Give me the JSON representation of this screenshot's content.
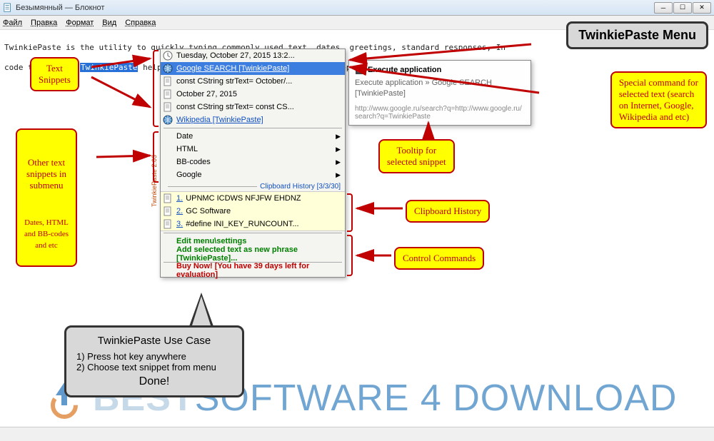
{
  "window": {
    "title": "Безымянный — Блокнот"
  },
  "menubar": [
    "Файл",
    "Правка",
    "Формат",
    "Вид",
    "Справка"
  ],
  "editor": {
    "line1_pre": "TwinkiePaste is the utility to quickly typing commonly used text, dates, greetings, standard responses, In",
    "line2_pre": "code templates. ",
    "sel": "TwinkiePaste",
    "line2_post": " helps to quickly type text in almost any application, thus saving a lot of ti"
  },
  "popup": {
    "version_label": "TwinkiePaste 2.03",
    "top": [
      {
        "icon": "clock-icon",
        "label": "Tuesday, October 27, 2015 13:2..."
      },
      {
        "icon": "globe-icon",
        "label": "Google SEARCH [TwinkiePaste]",
        "hl": true,
        "link": true
      },
      {
        "icon": "page-icon",
        "label": "const CString strText= October/..."
      },
      {
        "icon": "page-icon",
        "label": "October 27, 2015"
      },
      {
        "icon": "page-icon",
        "label": "const CString strText= const CS..."
      },
      {
        "icon": "globe-icon",
        "label": "Wikipedia [TwinkiePaste]",
        "link": true
      }
    ],
    "sub": [
      {
        "label": "Date"
      },
      {
        "label": "HTML"
      },
      {
        "label": "BB-codes"
      },
      {
        "label": "Google"
      }
    ],
    "clip_header": "Clipboard History [3/3/30]",
    "clips": [
      {
        "n": "1.",
        "text": "UPNMC ICDWS NFJFW EHDNZ"
      },
      {
        "n": "2.",
        "text": "GC Software"
      },
      {
        "n": "3.",
        "text": "#define INI_KEY_RUNCOUNT..."
      }
    ],
    "cmds": {
      "edit": "Edit menu\\settings",
      "add": "Add selected text as new phrase [TwinkiePaste]...",
      "buy": "Buy Now! [You have 39 days left for evaluation]"
    }
  },
  "tooltip": {
    "title": "Execute application",
    "body": "Execute application » Google SEARCH [TwinkiePaste]",
    "url": "http://www.google.ru/search?q=http://www.google.ru/search?q=TwinkiePaste"
  },
  "callouts": {
    "menu_title": "TwinkiePaste Menu",
    "text_snippets": "Text\nSnippets",
    "other": "Other text\nsnippets in\nsubmenu",
    "other_sub": "Dates, HTML\nand BB-codes\nand etc",
    "tooltip": "Tooltip for\nselected snippet",
    "special": "Special command for\nselected text (search\non Internet, Google,\nWikipedia and etc)",
    "clip": "Clipboard History",
    "control": "Control Commands"
  },
  "usecase": {
    "title": "TwinkiePaste Use Case",
    "l1": "1) Press hot key anywhere",
    "l2": "2) Choose text snippet from menu",
    "done": "Done!"
  },
  "watermark": {
    "t1": "BEST",
    "t2": "SOFTWARE 4 DOWNLOAD"
  }
}
